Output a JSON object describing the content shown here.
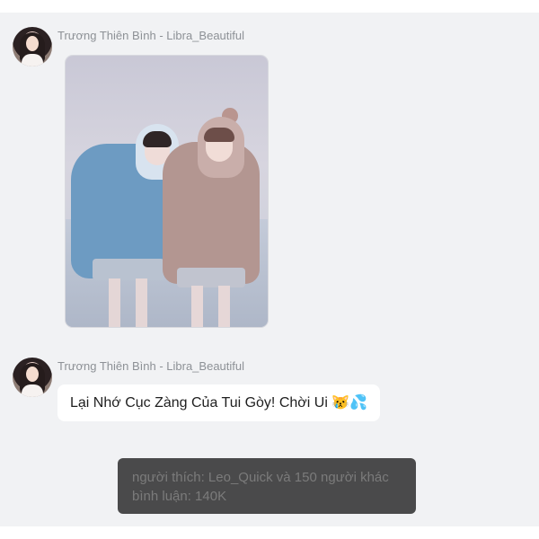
{
  "messages": [
    {
      "sender": "Trương Thiên Bình - Libra_Beautiful",
      "type": "image"
    },
    {
      "sender": "Trương Thiên Bình - Libra_Beautiful",
      "type": "text",
      "text": "Lại Nhớ Cục Zàng Của Tui Gòy! Chời Ui 😿💦"
    }
  ],
  "toast": {
    "likes": "người thích: Leo_Quick và 150 người khác",
    "comments": "bình luận: 140K"
  },
  "colors": {
    "chat_background": "#f1f2f4",
    "bubble": "#ffffff",
    "sender_text": "#8d9196",
    "toast_background": "#3c3c3c",
    "toast_text": "#7b7b7b"
  }
}
